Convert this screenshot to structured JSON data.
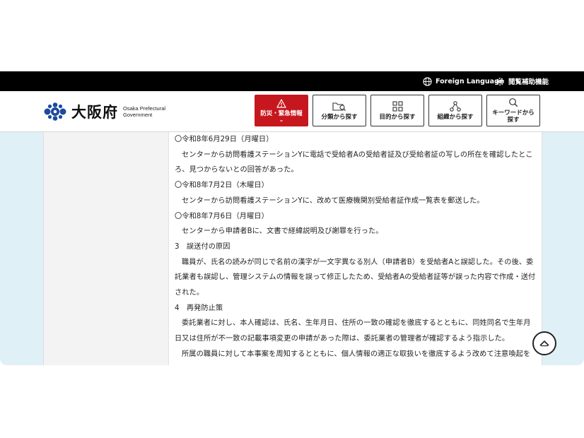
{
  "topbar": {
    "foreign_language": "Foreign Language",
    "accessibility": "閲覧補助機能"
  },
  "header": {
    "logo_text": "大阪府",
    "logo_en_line1": "Osaka Prefectural",
    "logo_en_line2": "Government",
    "nav": {
      "emergency": "防災・緊急情報",
      "by_category": "分類から探す",
      "by_purpose": "目的から探す",
      "by_organization": "組織から探す",
      "by_keyword_line1": "キーワードから",
      "by_keyword_line2": "探す"
    }
  },
  "article": {
    "lines": [
      "〇令和8年6月29日（月曜日）",
      "センターから訪問看護ステーションYに電話で受給者Aの受給者証及び受給者証の写しの所在を確認したところ、見つからないとの回答があった。",
      "〇令和8年7月2日（木曜日）",
      "センターから訪問看護ステーションYに、改めて医療機関別受給者証作成一覧表を郵送した。",
      "〇令和8年7月6日（月曜日）",
      "センターから申請者Bに、文書で経緯説明及び謝罪を行った。",
      "3　誤送付の原因",
      "職員が、氏名の読みが同じで名前の漢字が一文字異なる別人（申請者B）を受給者Aと誤認した。その後、委託業者も誤認し、管理システムの情報を誤って修正したため、受給者Aの受給者証等が誤った内容で作成・送付された。",
      "4　再発防止策",
      "委託業者に対し、本人確認は、氏名、生年月日、住所の一致の確認を徹底するとともに、同姓同名で生年月日又は住所が不一致の記載事項変更の申請があった際は、委託業者の管理者が確認するよう指示した。",
      "所属の職員に対して本事案を周知するとともに、個人情報の適正な取扱いを徹底するよう改めて注意喚起を行う。"
    ]
  },
  "colors": {
    "topbar_bg": "#000000",
    "emergency_red": "#c7171e",
    "logo_blue": "#1b4aa0"
  },
  "icons": {
    "foreign_language": "globe-icon",
    "accessibility": "gear-icon",
    "emergency": "warning-icon",
    "by_category": "folder-search-icon",
    "by_purpose": "grid-icon",
    "by_organization": "org-chart-icon",
    "by_keyword": "search-icon",
    "page_top": "chevron-up-icon"
  }
}
